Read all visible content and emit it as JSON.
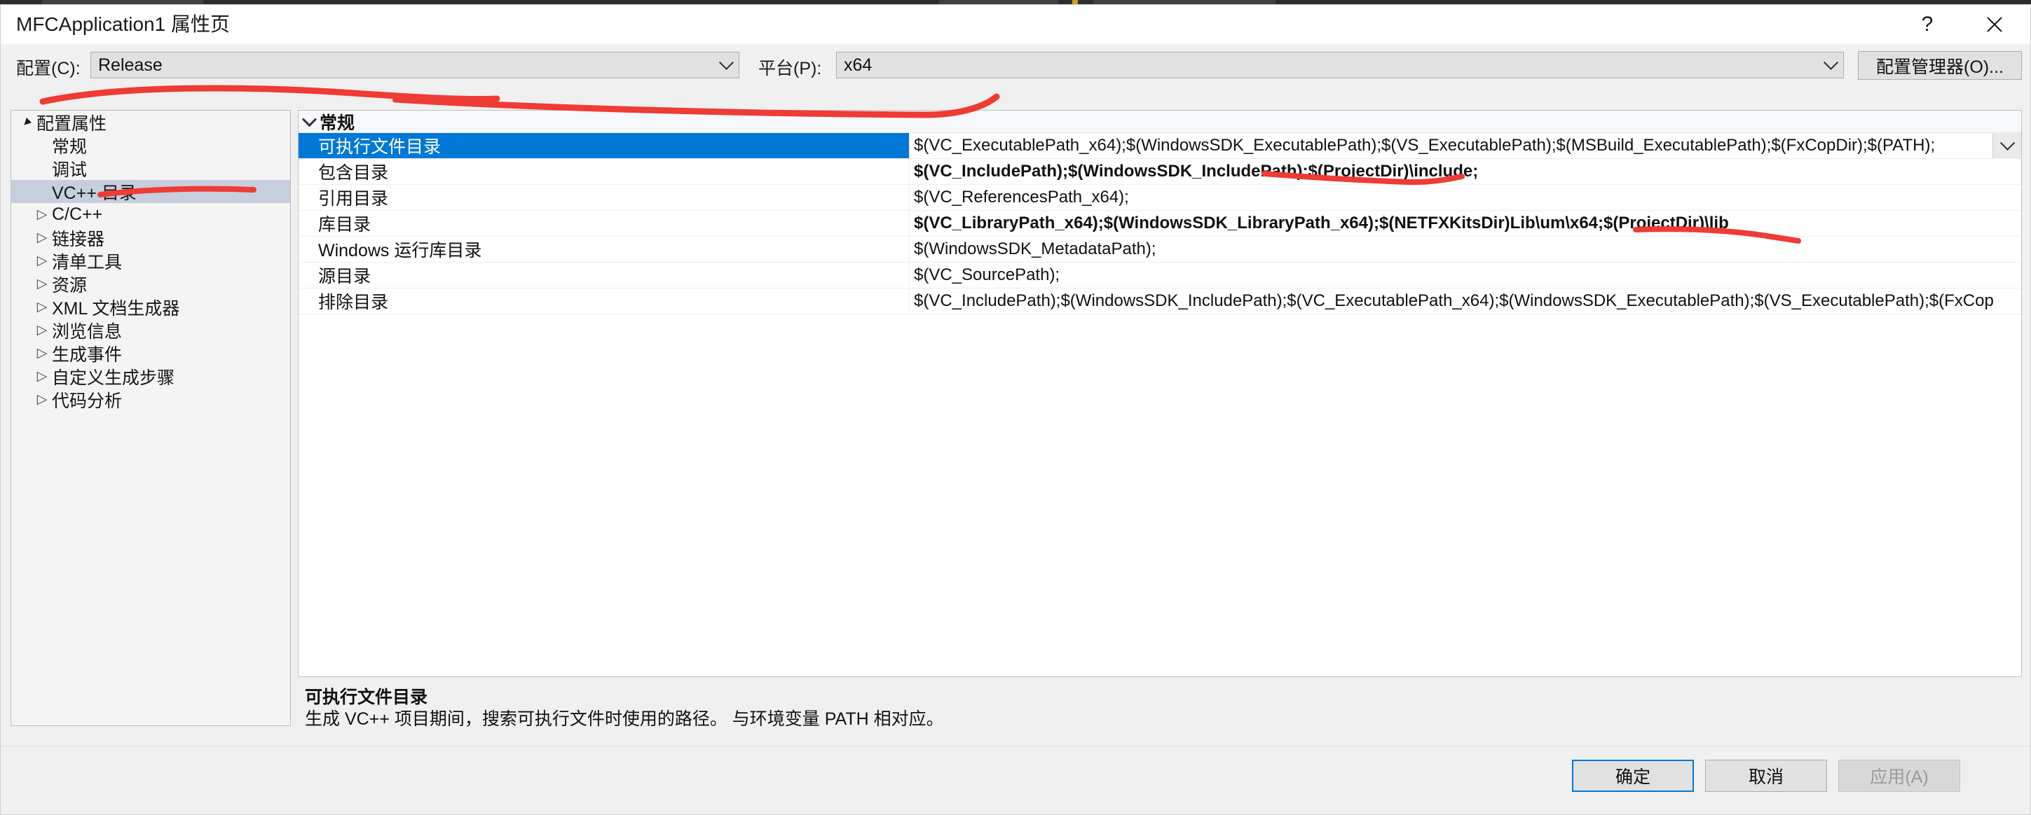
{
  "window": {
    "title": "MFCApplication1 属性页",
    "help_label": "?",
    "close_label": "✕"
  },
  "config_bar": {
    "configuration_label": "配置(C):",
    "configuration_value": "Release",
    "platform_label": "平台(P):",
    "platform_value": "x64",
    "config_manager_button": "配置管理器(O)..."
  },
  "tree": {
    "items": [
      {
        "label": "配置属性",
        "indent": 0,
        "expander": "expanded",
        "selected": false
      },
      {
        "label": "常规",
        "indent": 1,
        "expander": "none",
        "selected": false
      },
      {
        "label": "调试",
        "indent": 1,
        "expander": "none",
        "selected": false
      },
      {
        "label": "VC++ 目录",
        "indent": 1,
        "expander": "none",
        "selected": true
      },
      {
        "label": "C/C++",
        "indent": 1,
        "expander": "collapsed",
        "selected": false
      },
      {
        "label": "链接器",
        "indent": 1,
        "expander": "collapsed",
        "selected": false
      },
      {
        "label": "清单工具",
        "indent": 1,
        "expander": "collapsed",
        "selected": false
      },
      {
        "label": "资源",
        "indent": 1,
        "expander": "collapsed",
        "selected": false
      },
      {
        "label": "XML 文档生成器",
        "indent": 1,
        "expander": "collapsed",
        "selected": false
      },
      {
        "label": "浏览信息",
        "indent": 1,
        "expander": "collapsed",
        "selected": false
      },
      {
        "label": "生成事件",
        "indent": 1,
        "expander": "collapsed",
        "selected": false
      },
      {
        "label": "自定义生成步骤",
        "indent": 1,
        "expander": "collapsed",
        "selected": false
      },
      {
        "label": "代码分析",
        "indent": 1,
        "expander": "collapsed",
        "selected": false
      }
    ]
  },
  "grid": {
    "group_label": "常规",
    "rows": [
      {
        "name": "可执行文件目录",
        "value": "$(VC_ExecutablePath_x64);$(WindowsSDK_ExecutablePath);$(VS_ExecutablePath);$(MSBuild_ExecutablePath);$(FxCopDir);$(PATH);",
        "bold": false,
        "selected": true
      },
      {
        "name": "包含目录",
        "value": "$(VC_IncludePath);$(WindowsSDK_IncludePath);$(ProjectDir)\\include;",
        "bold": true,
        "selected": false
      },
      {
        "name": "引用目录",
        "value": "$(VC_ReferencesPath_x64);",
        "bold": false,
        "selected": false
      },
      {
        "name": "库目录",
        "value": "$(VC_LibraryPath_x64);$(WindowsSDK_LibraryPath_x64);$(NETFXKitsDir)Lib\\um\\x64;$(ProjectDir)\\lib",
        "bold": true,
        "selected": false
      },
      {
        "name": "Windows 运行库目录",
        "value": "$(WindowsSDK_MetadataPath);",
        "bold": false,
        "selected": false
      },
      {
        "name": "源目录",
        "value": "$(VC_SourcePath);",
        "bold": false,
        "selected": false
      },
      {
        "name": "排除目录",
        "value": "$(VC_IncludePath);$(WindowsSDK_IncludePath);$(VC_ExecutablePath_x64);$(WindowsSDK_ExecutablePath);$(VS_ExecutablePath);$(FxCop",
        "bold": false,
        "selected": false
      }
    ]
  },
  "description": {
    "title": "可执行文件目录",
    "body": "生成 VC++ 项目期间，搜索可执行文件时使用的路径。  与环境变量 PATH 相对应。"
  },
  "footer": {
    "ok_label": "确定",
    "cancel_label": "取消",
    "apply_label": "应用(A)"
  },
  "annotations": {
    "ink_color": "#ef3b36",
    "marks": [
      "underline-configuration-and-platform",
      "underline-vcpp-directories-tree-item",
      "underline-projectdir-include",
      "underline-projectdir-lib"
    ]
  },
  "colors": {
    "accent": "#0078d7",
    "selection_row": "#0078d7",
    "tree_selection": "#c7cede",
    "dialog_bg": "#f0f0f0",
    "grid_bg": "#ffffff",
    "ink": "#ef3b36"
  }
}
